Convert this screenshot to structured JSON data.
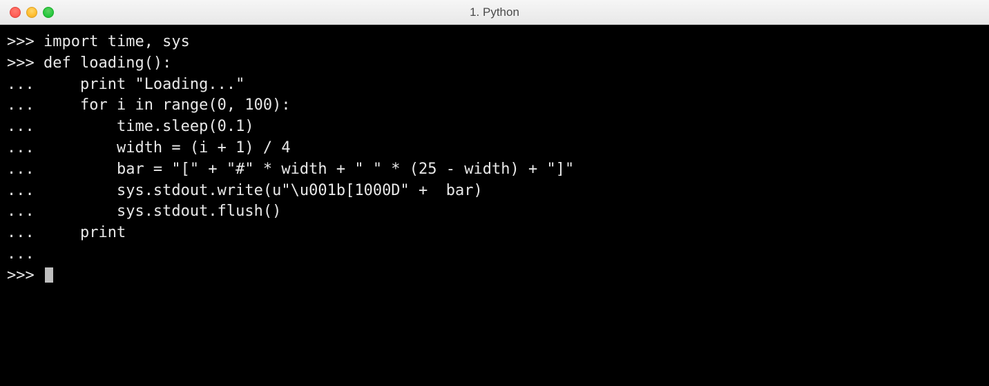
{
  "window": {
    "title": "1. Python"
  },
  "terminal": {
    "lines": [
      {
        "prompt": ">>>",
        "text": " import time, sys"
      },
      {
        "prompt": ">>>",
        "text": " def loading():"
      },
      {
        "prompt": "...",
        "text": "     print \"Loading...\""
      },
      {
        "prompt": "...",
        "text": "     for i in range(0, 100):"
      },
      {
        "prompt": "...",
        "text": "         time.sleep(0.1)"
      },
      {
        "prompt": "...",
        "text": "         width = (i + 1) / 4"
      },
      {
        "prompt": "...",
        "text": "         bar = \"[\" + \"#\" * width + \" \" * (25 - width) + \"]\""
      },
      {
        "prompt": "...",
        "text": "         sys.stdout.write(u\"\\u001b[1000D\" +  bar)"
      },
      {
        "prompt": "...",
        "text": "         sys.stdout.flush()"
      },
      {
        "prompt": "...",
        "text": "     print"
      },
      {
        "prompt": "...",
        "text": ""
      },
      {
        "prompt": ">>>",
        "text": " ",
        "cursor": true
      }
    ]
  }
}
